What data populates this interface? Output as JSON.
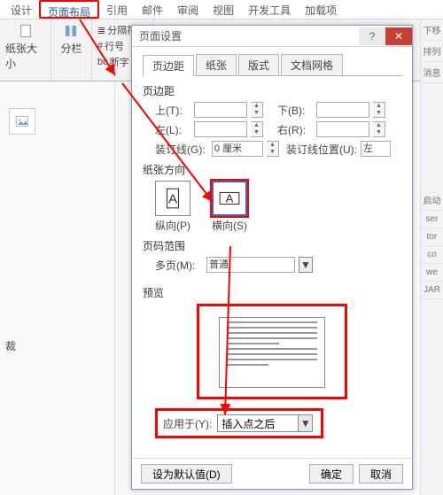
{
  "ribbon": {
    "tabs": [
      "设计",
      "页面布局",
      "引用",
      "邮件",
      "审阅",
      "视图",
      "开发工具",
      "加载项"
    ],
    "active_index": 1,
    "size_label": "纸张大小",
    "columns_label": "分栏",
    "breaks": "分隔符",
    "linenum": "行号",
    "hyphen": "断字",
    "shift_label": "下移"
  },
  "rightstrip": [
    "排列",
    "消息",
    "启动",
    "ser",
    "tor",
    "co",
    "we",
    "JAR"
  ],
  "dialog": {
    "title": "页面设置",
    "help": "?",
    "close": "✕",
    "tabs": [
      "页边距",
      "纸张",
      "版式",
      "文档网格"
    ],
    "active_tab": 0,
    "sect_margins": "页边距",
    "top": "上(T):",
    "bottom": "下(B):",
    "left": "左(L):",
    "right": "右(R):",
    "gutter": "装订线(G):",
    "gutter_val": "0 厘米",
    "gutter_pos": "装订线位置(U):",
    "gutter_pos_val": "左",
    "sect_orient": "纸张方向",
    "orient_portrait": "纵向(P)",
    "orient_landscape": "横向(S)",
    "sect_pages": "页码范围",
    "multi": "多页(M):",
    "multi_val": "普通",
    "sect_preview": "预览",
    "apply_label": "应用于(Y):",
    "apply_val": "插入点之后",
    "default_btn": "设为默认值(D)",
    "ok": "确定",
    "cancel": "取消"
  }
}
